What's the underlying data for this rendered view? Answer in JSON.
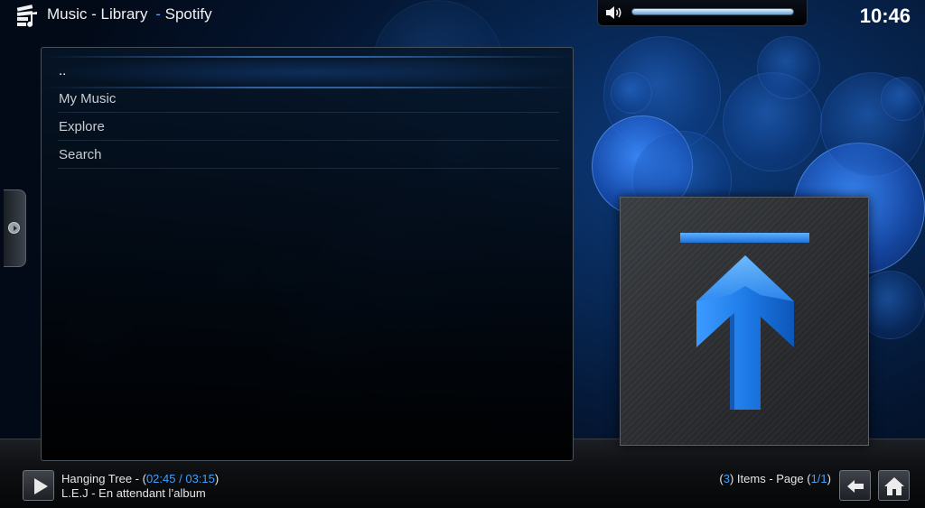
{
  "header": {
    "window_title": "Music - Library",
    "addon_separator": "-",
    "addon_name": "Spotify",
    "clock": "10:46",
    "logo_icon": "music-library-icon"
  },
  "volume": {
    "icon": "speaker-icon",
    "level_fraction": 1.0
  },
  "list": {
    "items": [
      {
        "label": "..",
        "focused": true
      },
      {
        "label": "My Music",
        "focused": false
      },
      {
        "label": "Explore",
        "focused": false
      },
      {
        "label": "Search",
        "focused": false
      }
    ]
  },
  "thumbnail": {
    "icon": "parent-folder-up-arrow-icon"
  },
  "now_playing": {
    "title": "Hanging Tree",
    "title_sep": " - (",
    "elapsed": "02:45",
    "time_sep": " / ",
    "duration": "03:15",
    "time_close": ")",
    "subtitle": "L.E.J - En attendant l’album",
    "play_icon": "play-icon"
  },
  "footer": {
    "items_open": "(",
    "items_count": "3",
    "items_text": ") Items - Page (",
    "page_current": "1",
    "page_sep": "/",
    "page_total": "1",
    "page_close": ")",
    "back_icon": "back-arrow-icon",
    "home_icon": "home-icon"
  },
  "colors": {
    "accent": "#3ea1ff",
    "background": "#072550"
  }
}
